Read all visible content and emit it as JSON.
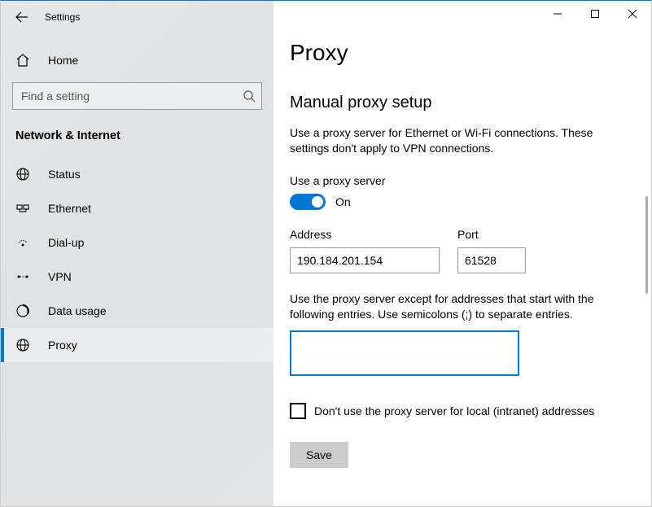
{
  "app": {
    "title": "Settings"
  },
  "sidebar": {
    "home": "Home",
    "search_placeholder": "Find a setting",
    "section": "Network & Internet",
    "items": [
      {
        "label": "Status"
      },
      {
        "label": "Ethernet"
      },
      {
        "label": "Dial-up"
      },
      {
        "label": "VPN"
      },
      {
        "label": "Data usage"
      },
      {
        "label": "Proxy"
      }
    ],
    "selected_index": 5
  },
  "page": {
    "title": "Proxy",
    "section_title": "Manual proxy setup",
    "section_desc": "Use a proxy server for Ethernet or Wi-Fi connections. These settings don't apply to VPN connections.",
    "use_proxy_label": "Use a proxy server",
    "toggle_on": true,
    "toggle_text": "On",
    "address_label": "Address",
    "address_value": "190.184.201.154",
    "port_label": "Port",
    "port_value": "61528",
    "exceptions_desc": "Use the proxy server except for addresses that start with the following entries. Use semicolons (;) to separate entries.",
    "exceptions_value": "",
    "local_bypass_label": "Don't use the proxy server for local (intranet) addresses",
    "local_bypass_checked": false,
    "save_label": "Save"
  }
}
